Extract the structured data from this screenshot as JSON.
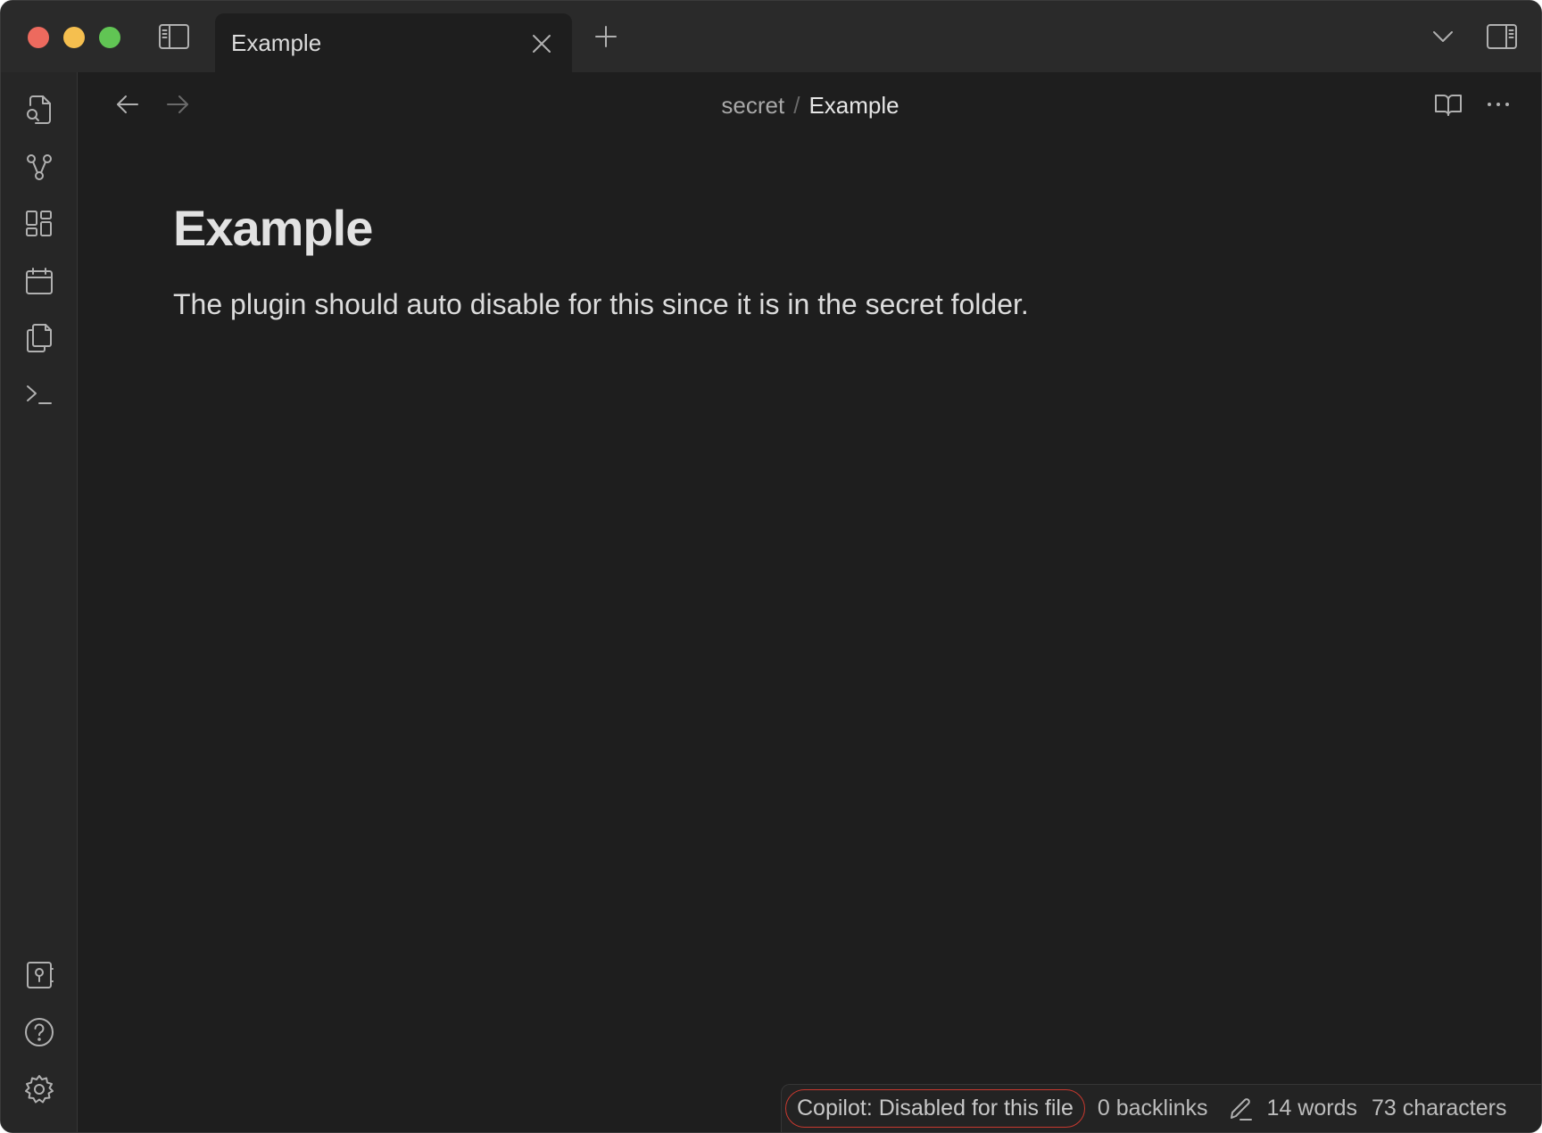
{
  "tab": {
    "label": "Example"
  },
  "breadcrumb": {
    "folder": "secret",
    "separator": "/",
    "file": "Example"
  },
  "document": {
    "title": "Example",
    "body": "The plugin should auto disable for this since it is in the secret folder."
  },
  "statusbar": {
    "copilot": "Copilot: Disabled for this file",
    "backlinks": "0 backlinks",
    "words": "14 words",
    "characters": "73 characters"
  },
  "ribbon": {
    "icons": [
      "quick-switcher-icon",
      "graph-view-icon",
      "canvas-icon",
      "daily-note-icon",
      "templates-icon",
      "command-palette-icon",
      "vault-icon",
      "help-icon",
      "settings-icon"
    ]
  },
  "colors": {
    "background": "#1e1e1e",
    "titlebar": "#2a2a2a",
    "copilot_outline": "#c8392f"
  }
}
